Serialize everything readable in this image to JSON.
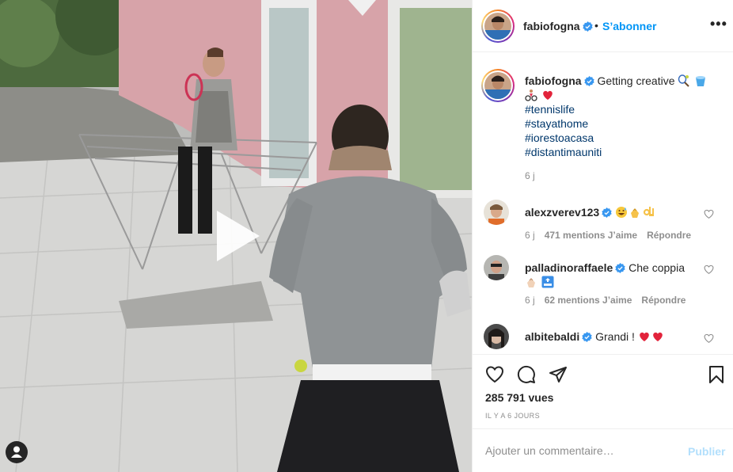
{
  "post": {
    "username": "fabiofogna",
    "follow_label": "S’abonner",
    "more_label": "•••",
    "separator": "•"
  },
  "caption": {
    "username": "fabiofogna",
    "text": "Getting creative",
    "hashtags": [
      "#tennislife",
      "#stayathome",
      "#iorestoacasa",
      "#distantimauniti"
    ],
    "time": "6 j"
  },
  "comments": [
    {
      "username": "alexzverev123",
      "text": "",
      "emojis": [
        "grinning-sweat-emoji",
        "clapping-hands-emoji",
        "ok-hand-emoji"
      ],
      "time": "6 j",
      "likes": "471 mentions J’aime",
      "reply": "Répondre"
    },
    {
      "username": "palladinoraffaele",
      "text": "Che coppia",
      "emojis": [
        "clapping-hands-emoji",
        "top-arrow-emoji"
      ],
      "time": "6 j",
      "likes": "62 mentions J’aime",
      "reply": "Répondre"
    },
    {
      "username": "albitebaldi",
      "text": "Grandi !",
      "emojis": [
        "red-heart-emoji",
        "red-heart-emoji"
      ]
    }
  ],
  "stats": {
    "views": "285 791 vues",
    "posted_ago": "Il y a 6 jours"
  },
  "composer": {
    "placeholder": "Ajouter un commentaire…",
    "post_label": "Publier"
  },
  "colors": {
    "accent": "#0095f6",
    "hashtag": "#00376b",
    "muted": "#8e8e8e",
    "border": "#efefef",
    "post_disabled": "#b2dffc",
    "heart": "#ed4956"
  }
}
